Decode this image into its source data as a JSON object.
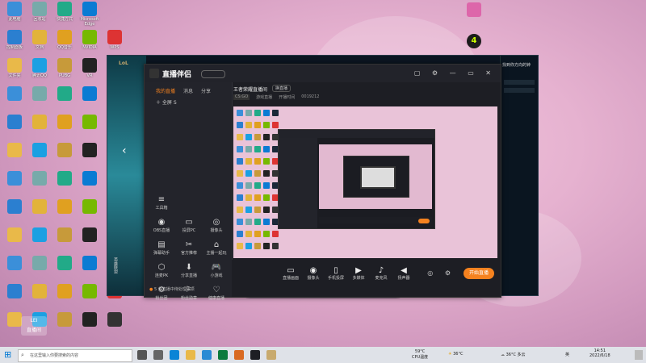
{
  "desktop": {
    "icons": [
      {
        "label": "此电脑",
        "color": "#3b8fd9"
      },
      {
        "label": "回收站",
        "color": "#7aa"
      },
      {
        "label": "快捷方式",
        "color": "#2a8"
      },
      {
        "label": "Microsoft Edge",
        "color": "#0a7bd3"
      },
      {
        "label": "Steam",
        "color": "#1b2838"
      },
      {
        "label": "控制面板",
        "color": "#2b7fd0"
      },
      {
        "label": "文档",
        "color": "#e2b33a"
      },
      {
        "label": "QQ音乐",
        "color": "#e0a020"
      },
      {
        "label": "NVIDIA",
        "color": "#76b900"
      },
      {
        "label": "WPS",
        "color": "#d33"
      },
      {
        "label": "文件夹",
        "color": "#e9b949"
      },
      {
        "label": "腾讯QQ",
        "color": "#1ba0e2"
      },
      {
        "label": "PUBG",
        "color": "#c79a3a"
      },
      {
        "label": "VR",
        "color": "#222"
      },
      {
        "label": "OBS",
        "color": "#333"
      }
    ],
    "weather": "36°C",
    "cpu_temp": "59°C",
    "cpu_label": "CPU温度",
    "ime": "英",
    "status_text": "多云",
    "time": "14:51",
    "date": "2022/6/18",
    "search_placeholder": "在这里输入你要搜索的内容",
    "watermark_line1": "LEI",
    "watermark_line2": "直播间",
    "top_right_badge": "4"
  },
  "game_client": {
    "title": "LEAGUE OF LEGENDS",
    "right_text": "找到你方向的钟",
    "side_label": "英雄联盟"
  },
  "app": {
    "title": "直播伴侣",
    "tabs": [
      "我的直播",
      "消息",
      "分享"
    ],
    "scene": "全屏 S",
    "room_title": "王者荣耀直播间",
    "room_tag": "换直播",
    "room_meta": [
      "CS:GO",
      "游戏直播",
      "开播时间",
      "0019212"
    ],
    "tools": [
      {
        "label": "工具箱",
        "glyph": "≡"
      },
      {
        "label": "OBS直播",
        "glyph": "◉"
      },
      {
        "label": "投屏PC",
        "glyph": "▭"
      },
      {
        "label": "摄像头",
        "glyph": "◎"
      },
      {
        "label": "弹幕助手",
        "glyph": "▤"
      },
      {
        "label": "官方推荐",
        "glyph": "✂"
      },
      {
        "label": "主播一起玩",
        "glyph": "⌂"
      },
      {
        "label": "连麦PK",
        "glyph": "⬡"
      },
      {
        "label": "分享直播",
        "glyph": "⬇"
      },
      {
        "label": "小游戏",
        "glyph": "🎮"
      },
      {
        "label": "粉丝团",
        "glyph": "⚙"
      },
      {
        "label": "粉丝勋章",
        "glyph": "⚐"
      },
      {
        "label": "健康直播",
        "glyph": "♡"
      }
    ],
    "notice": "5 条直播中待处理事项",
    "bottom": [
      {
        "label": "直播画面",
        "glyph": "▭"
      },
      {
        "label": "摄像头",
        "glyph": "◉"
      },
      {
        "label": "手机投屏",
        "glyph": "▯"
      },
      {
        "label": "多媒体",
        "glyph": "▶"
      },
      {
        "label": "麦克风",
        "glyph": "♪"
      },
      {
        "label": "扬声器",
        "glyph": "◀"
      }
    ],
    "start_button": "开始直播"
  }
}
